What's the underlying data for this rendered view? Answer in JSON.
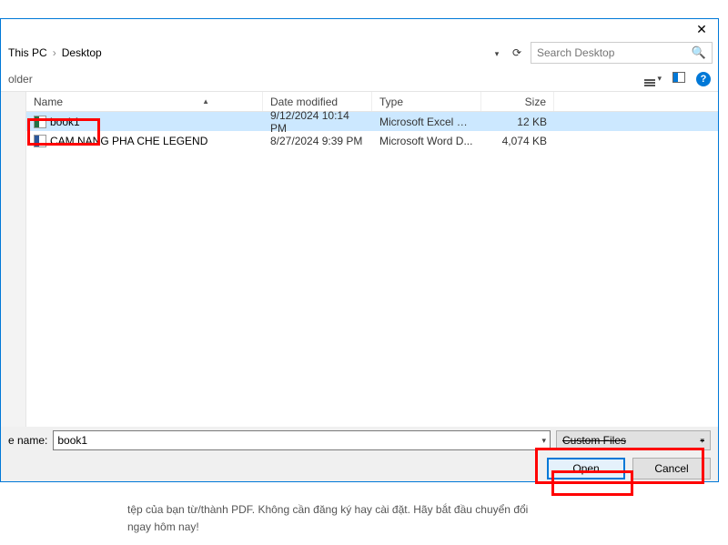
{
  "bg_text_line1": "tệp của bạn từ/thành PDF. Không cần đăng ký hay cài đặt. Hãy bắt đầu chuyển đổi",
  "bg_text_line2": "ngay hôm nay!",
  "breadcrumb": {
    "part1": "This PC",
    "part2": "Desktop",
    "sep": "›"
  },
  "search": {
    "placeholder": "Search Desktop"
  },
  "toolbar_left": "older",
  "headers": {
    "name": "Name",
    "date": "Date modified",
    "type": "Type",
    "size": "Size"
  },
  "files": [
    {
      "name": "book1",
      "date": "9/12/2024 10:14 PM",
      "type": "Microsoft Excel W...",
      "size": "12 KB",
      "icon": "excel",
      "selected": true
    },
    {
      "name": "CAM NANG PHA CHE LEGEND",
      "date": "8/27/2024 9:39 PM",
      "type": "Microsoft Word D...",
      "size": "4,074 KB",
      "icon": "word",
      "selected": false
    }
  ],
  "filename_label": "e name:",
  "filename_value": "book1",
  "filetype_label": "Custom Files",
  "buttons": {
    "open": "Open",
    "cancel": "Cancel"
  },
  "help_icon": "?"
}
